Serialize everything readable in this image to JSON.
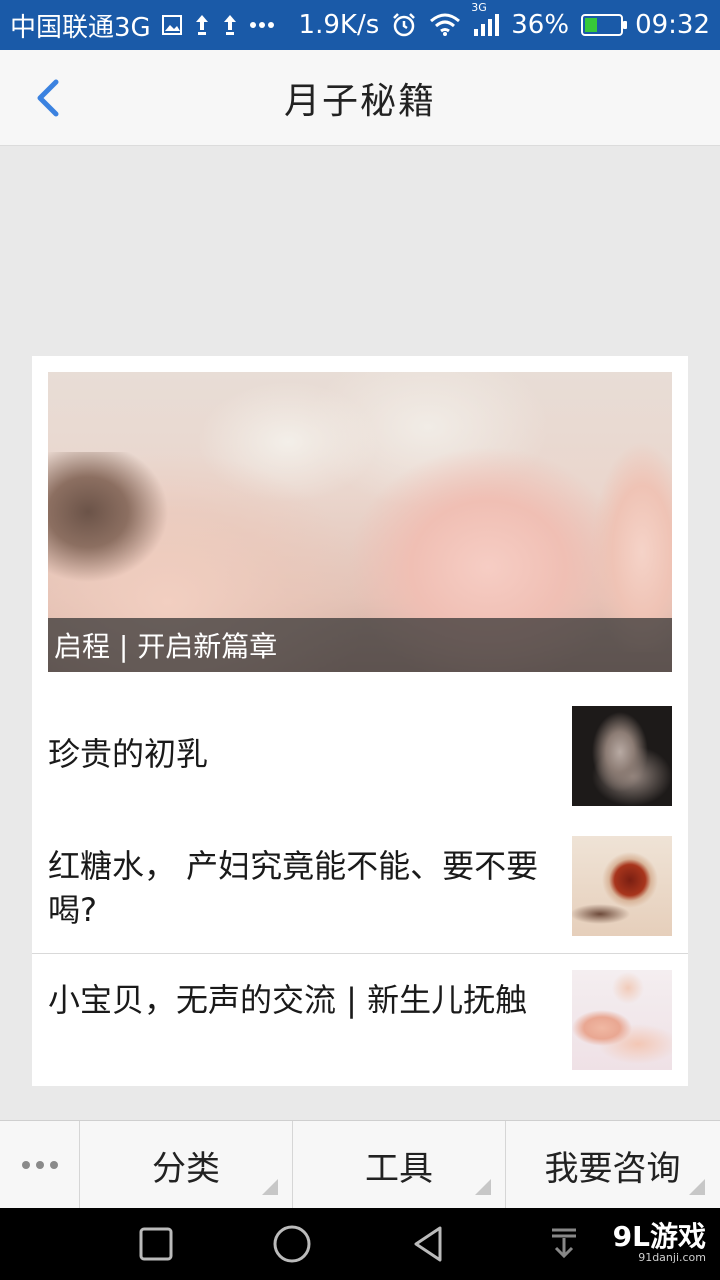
{
  "status_bar": {
    "carrier": "中国联通3G",
    "speed": "1.9K/s",
    "network_label": "3G",
    "battery": "36%",
    "time": "09:32",
    "battery_level": 0.36,
    "icons": [
      "image-icon",
      "notification-icon",
      "notification-icon",
      "more-icon",
      "alarm-icon",
      "wifi-icon",
      "signal-icon",
      "battery-icon"
    ]
  },
  "nav": {
    "title": "月子秘籍",
    "back_icon": "chevron-left-icon",
    "accent_color": "#3b82e0"
  },
  "featured": {
    "caption": "启程 | 开启新篇章"
  },
  "articles": [
    {
      "title": "珍贵的初乳"
    },
    {
      "title": "红糖水， 产妇究竟能不能、要不要喝?"
    },
    {
      "title": "小宝贝，无声的交流 | 新生儿抚触"
    }
  ],
  "tabbar": {
    "more_icon": "more-dots-icon",
    "tabs": [
      {
        "label": "分类"
      },
      {
        "label": "工具"
      },
      {
        "label": "我要咨询"
      }
    ]
  },
  "system_nav": {
    "buttons": [
      "square-icon",
      "circle-icon",
      "triangle-back-icon",
      "download-icon"
    ],
    "watermark": "9L游戏",
    "watermark_sub": "91danji.com"
  }
}
